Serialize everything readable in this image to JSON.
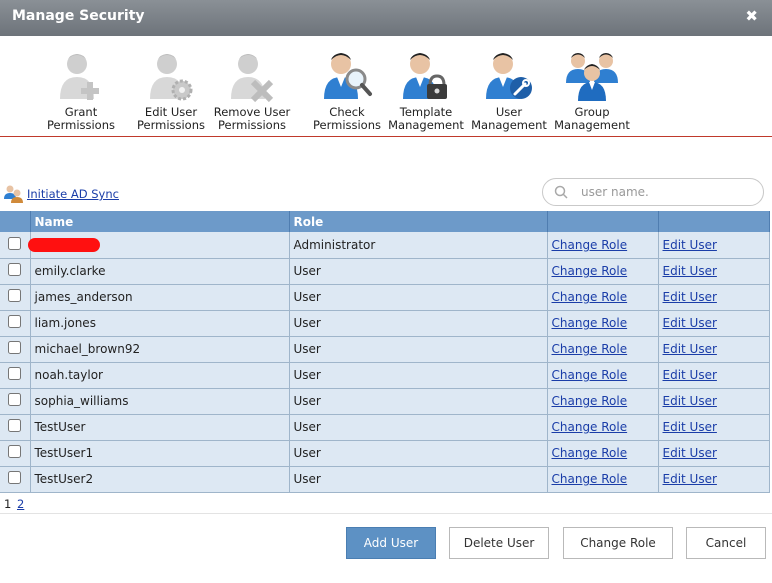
{
  "window": {
    "title": "Manage Security",
    "close_glyph": "✖"
  },
  "toolbar": [
    {
      "label": "Grant\nPermissions",
      "icon": "user-add-icon"
    },
    {
      "label": "Edit User\nPermissions",
      "icon": "user-gear-icon"
    },
    {
      "label": "Remove User\nPermissions",
      "icon": "user-remove-icon"
    },
    {
      "label": "Check\nPermissions",
      "icon": "user-search-icon"
    },
    {
      "label": "Template\nManagement",
      "icon": "user-lock-icon"
    },
    {
      "label": "User\nManagement",
      "icon": "user-wrench-icon"
    },
    {
      "label": "Group\nManagement",
      "icon": "user-group-icon"
    }
  ],
  "ad_sync": {
    "label": "Initiate AD Sync"
  },
  "search": {
    "placeholder": "user name."
  },
  "table": {
    "headers": [
      "Name",
      "Role",
      "",
      ""
    ],
    "change_role_label": "Change Role",
    "edit_user_label": "Edit User",
    "rows": [
      {
        "name": "",
        "role": "Administrator",
        "redacted": true
      },
      {
        "name": "emily.clarke",
        "role": "User"
      },
      {
        "name": "james_anderson",
        "role": "User"
      },
      {
        "name": "liam.jones",
        "role": "User"
      },
      {
        "name": "michael_brown92",
        "role": "User"
      },
      {
        "name": "noah.taylor",
        "role": "User"
      },
      {
        "name": "sophia_williams",
        "role": "User"
      },
      {
        "name": "TestUser",
        "role": "User"
      },
      {
        "name": "TestUser1",
        "role": "User"
      },
      {
        "name": "TestUser2",
        "role": "User"
      }
    ]
  },
  "pager": {
    "current": "1",
    "next": "2"
  },
  "buttons": {
    "add_user": "Add User",
    "delete_user": "Delete User",
    "change_role": "Change Role",
    "cancel": "Cancel"
  },
  "colors": {
    "header_bar": "#6d9ac9",
    "row_bg": "#dde8f3",
    "primary_button": "#5d91c4",
    "accent_line": "#c0392b"
  }
}
